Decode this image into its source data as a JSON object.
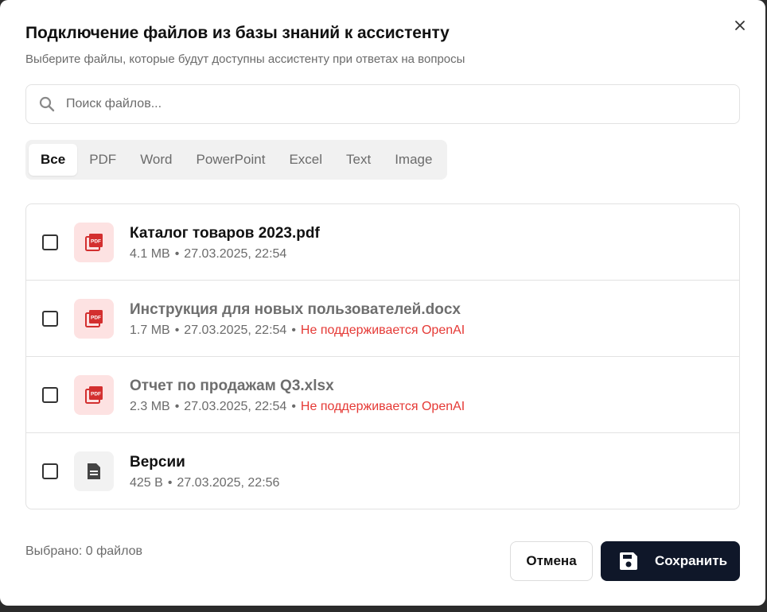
{
  "dialog": {
    "title": "Подключение файлов из базы знаний к ассистенту",
    "subtitle": "Выберите файлы, которые будут доступны ассистенту при ответах на вопросы",
    "close_icon": "close-icon"
  },
  "search": {
    "placeholder": "Поиск файлов...",
    "value": "",
    "icon": "search-icon"
  },
  "tabs": [
    {
      "label": "Все",
      "active": true
    },
    {
      "label": "PDF",
      "active": false
    },
    {
      "label": "Word",
      "active": false
    },
    {
      "label": "PowerPoint",
      "active": false
    },
    {
      "label": "Excel",
      "active": false
    },
    {
      "label": "Text",
      "active": false
    },
    {
      "label": "Image",
      "active": false
    }
  ],
  "files": [
    {
      "name": "Каталог товаров 2023.pdf",
      "size": "4.1 MB",
      "date": "27.03.2025, 22:54",
      "warning": "",
      "icon": "pdf-icon",
      "checked": false
    },
    {
      "name": "Инструкция для новых пользователей.docx",
      "size": "1.7 MB",
      "date": "27.03.2025, 22:54",
      "warning": "Не поддерживается OpenAI",
      "icon": "pdf-icon",
      "checked": false
    },
    {
      "name": "Отчет по продажам Q3.xlsx",
      "size": "2.3 MB",
      "date": "27.03.2025, 22:54",
      "warning": "Не поддерживается OpenAI",
      "icon": "pdf-icon",
      "checked": false
    },
    {
      "name": "Версии",
      "size": "425 B",
      "date": "27.03.2025, 22:56",
      "warning": "",
      "icon": "document-icon",
      "checked": false
    }
  ],
  "footer": {
    "selected_status": "Выбрано: 0 файлов",
    "cancel_label": "Отмена",
    "save_label": "Сохранить",
    "save_icon": "save-icon"
  },
  "colors": {
    "primary": "#0f1729",
    "pdf_accent": "#d32f2f",
    "pdf_bg": "#fde2e2",
    "warning": "#e53935"
  }
}
